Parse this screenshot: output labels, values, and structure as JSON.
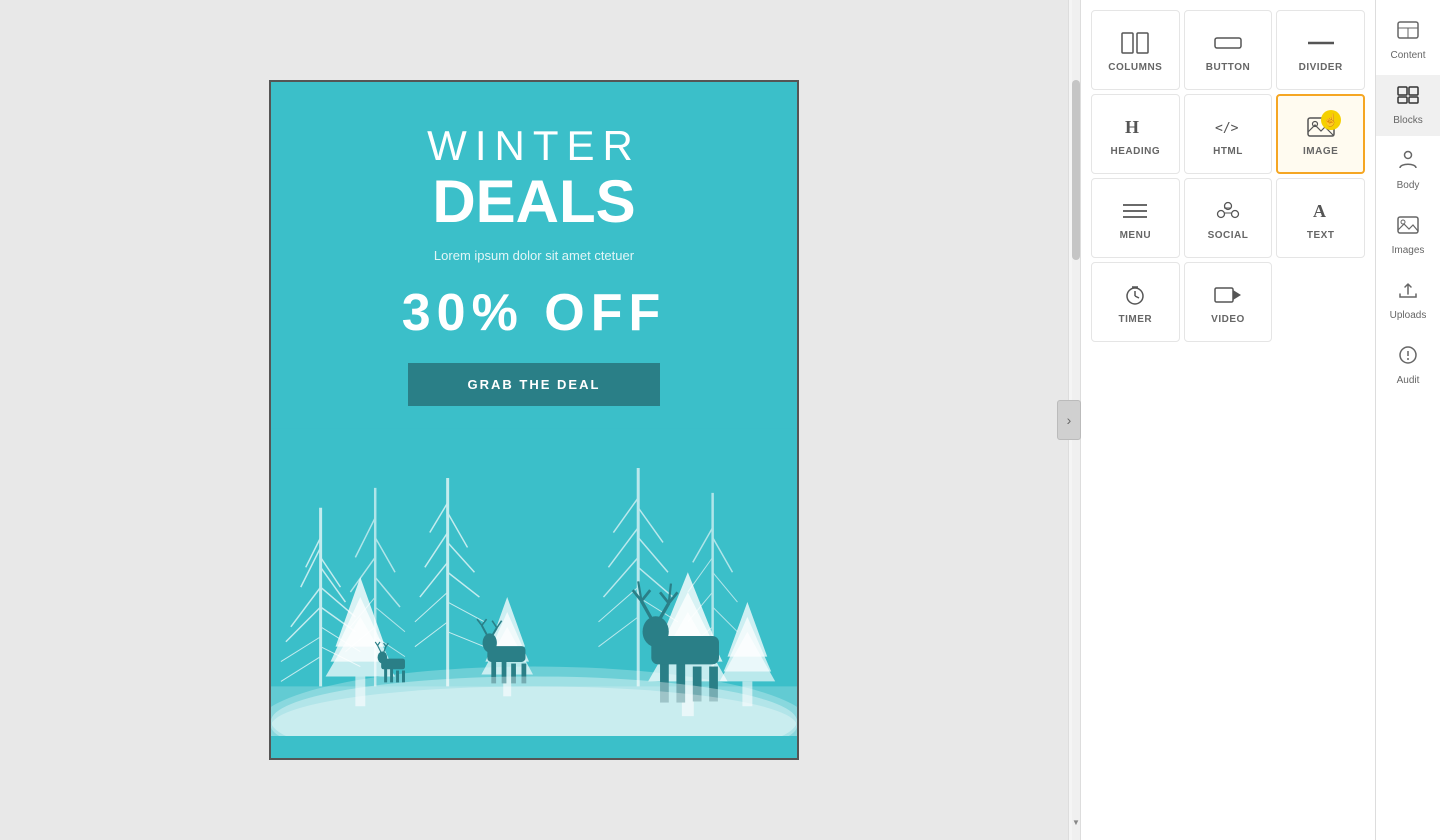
{
  "canvas": {
    "background": "#e8e8e8"
  },
  "email": {
    "title_line1": "WINTER",
    "title_line2": "DEALS",
    "subtitle": "Lorem ipsum dolor sit amet ctetuer",
    "discount": "30% OFF",
    "cta_button": "GRAB THE DEAL",
    "background_color": "#3bbfc9",
    "button_color": "#2a7f87"
  },
  "blocks_panel": {
    "items": [
      {
        "id": "columns",
        "label": "COLUMNS",
        "icon": "columns"
      },
      {
        "id": "button",
        "label": "BUTTON",
        "icon": "button"
      },
      {
        "id": "divider",
        "label": "DIVIDER",
        "icon": "divider"
      },
      {
        "id": "heading",
        "label": "HEADING",
        "icon": "heading"
      },
      {
        "id": "html",
        "label": "HTML",
        "icon": "html"
      },
      {
        "id": "image",
        "label": "IMAGE",
        "icon": "image",
        "active": true
      },
      {
        "id": "menu",
        "label": "MENU",
        "icon": "menu"
      },
      {
        "id": "social",
        "label": "SOCIAL",
        "icon": "social"
      },
      {
        "id": "text",
        "label": "TEXT",
        "icon": "text"
      },
      {
        "id": "timer",
        "label": "TIMER",
        "icon": "timer"
      },
      {
        "id": "video",
        "label": "VIDEO",
        "icon": "video"
      }
    ]
  },
  "right_sidebar": {
    "items": [
      {
        "id": "content",
        "label": "Content",
        "icon": "content",
        "active": false
      },
      {
        "id": "blocks",
        "label": "Blocks",
        "icon": "blocks",
        "active": true
      },
      {
        "id": "body",
        "label": "Body",
        "icon": "body"
      },
      {
        "id": "images",
        "label": "Images",
        "icon": "images"
      },
      {
        "id": "uploads",
        "label": "Uploads",
        "icon": "uploads"
      },
      {
        "id": "audit",
        "label": "Audit",
        "icon": "audit"
      }
    ]
  },
  "collapse_button": {
    "label": "›"
  }
}
